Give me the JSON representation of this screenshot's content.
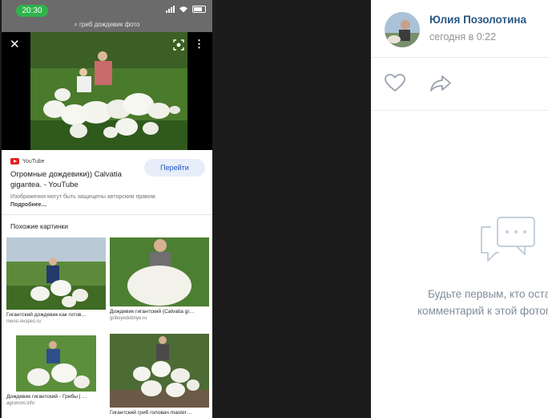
{
  "phone": {
    "status_time": "20:30",
    "search_query": "гриб дождевик фото",
    "result": {
      "source": "YouTube",
      "title": "Огромные дождевики)) Calvatia gigantea. - YouTube",
      "go_label": "Перейти",
      "copyright_text": "Изображения могут быть защищены авторским правом.",
      "more_label": "Подробнее…"
    },
    "similar_title": "Похожие картинки",
    "similar": [
      {
        "caption": "Гигантский дождевик как готов…",
        "source": "mens-recipes.ru"
      },
      {
        "caption": "Дождевик гигантский (Calvatia gi…",
        "source": "griboyedobnye.ru"
      },
      {
        "caption": "Дождевик гигантский - Грибы | …",
        "source": "agronom.info"
      },
      {
        "caption": "Гигантский гриб головач master…",
        "source": ""
      }
    ]
  },
  "post": {
    "author": "Юлия Позолотина",
    "time": "сегодня в 0:22",
    "empty_line1": "Будьте первым, кто оставит",
    "empty_line2": "комментарий к этой фотографии."
  },
  "colors": {
    "accent_link": "#2a5885",
    "pill_green": "#2fb34a",
    "go_button_text": "#1a56c6",
    "muted_text": "#818c99"
  },
  "icons": [
    "close-icon",
    "lens-icon",
    "more-icon",
    "youtube-icon",
    "like-icon",
    "share-icon",
    "comments-icon"
  ]
}
